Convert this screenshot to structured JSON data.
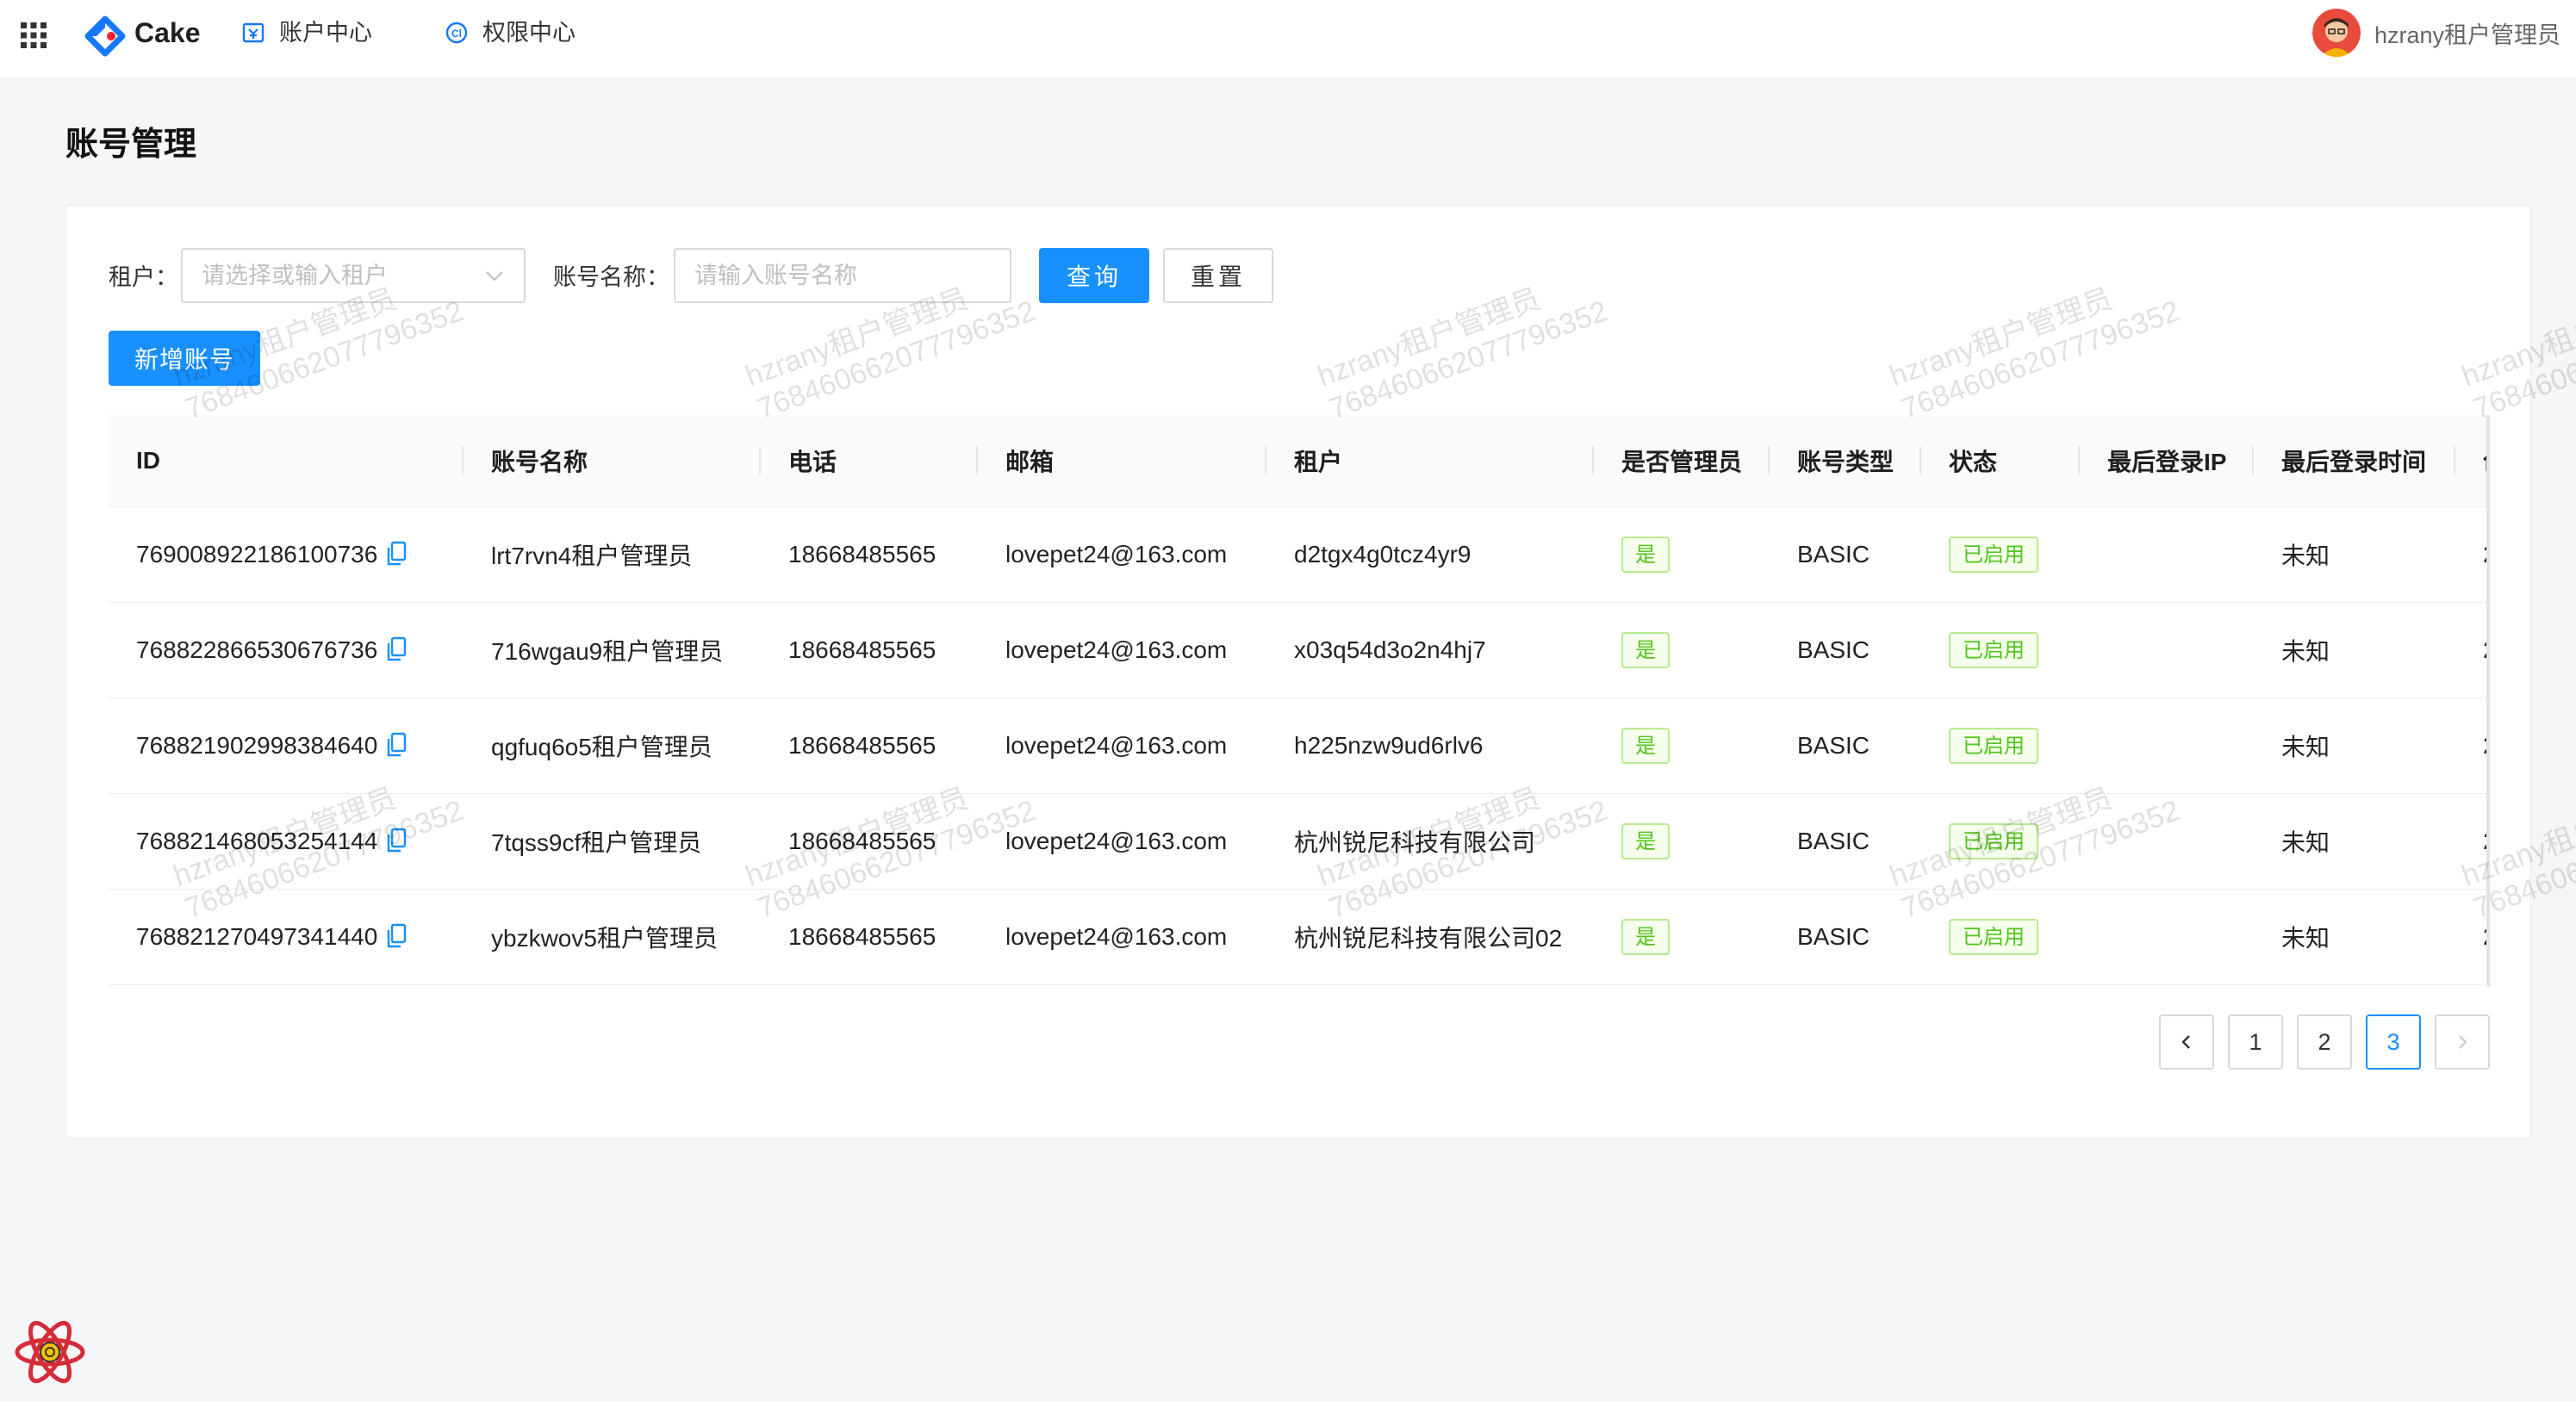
{
  "app": {
    "brand": "Cake",
    "nav": [
      {
        "label": "账户中心",
        "icon": "account-icon"
      },
      {
        "label": "权限中心",
        "icon": "permission-icon"
      }
    ],
    "user": {
      "name": "hzrany租户管理员",
      "avatar": "avatar-icon"
    }
  },
  "page": {
    "title": "账号管理"
  },
  "filters": {
    "tenant_label": "租户：",
    "tenant_placeholder": "请选择或输入租户",
    "account_label": "账号名称：",
    "account_placeholder": "请输入账号名称",
    "query_label": "查询",
    "reset_label": "重置"
  },
  "actions": {
    "add_label": "新增账号"
  },
  "table": {
    "columns": [
      "ID",
      "账号名称",
      "电话",
      "邮箱",
      "租户",
      "是否管理员",
      "账号类型",
      "状态",
      "最后登录IP",
      "最后登录时间",
      "创"
    ],
    "rows": [
      {
        "id": "769008922186100736",
        "name": "lrt7rvn4租户管理员",
        "phone": "18668485565",
        "email": "lovepet24@163.com",
        "tenant": "d2tgx4g0tcz4yr9",
        "admin": "是",
        "type": "BASIC",
        "status": "已启用",
        "ip": "",
        "last_login": "未知",
        "created": "2"
      },
      {
        "id": "768822866530676736",
        "name": "716wgau9租户管理员",
        "phone": "18668485565",
        "email": "lovepet24@163.com",
        "tenant": "x03q54d3o2n4hj7",
        "admin": "是",
        "type": "BASIC",
        "status": "已启用",
        "ip": "",
        "last_login": "未知",
        "created": "2"
      },
      {
        "id": "768821902998384640",
        "name": "qgfuq6o5租户管理员",
        "phone": "18668485565",
        "email": "lovepet24@163.com",
        "tenant": "h225nzw9ud6rlv6",
        "admin": "是",
        "type": "BASIC",
        "status": "已启用",
        "ip": "",
        "last_login": "未知",
        "created": "2"
      },
      {
        "id": "768821468053254144",
        "name": "7tqss9cf租户管理员",
        "phone": "18668485565",
        "email": "lovepet24@163.com",
        "tenant": "杭州锐尼科技有限公司",
        "admin": "是",
        "type": "BASIC",
        "status": "已启用",
        "ip": "",
        "last_login": "未知",
        "created": "2"
      },
      {
        "id": "768821270497341440",
        "name": "ybzkwov5租户管理员",
        "phone": "18668485565",
        "email": "lovepet24@163.com",
        "tenant": "杭州锐尼科技有限公司02",
        "admin": "是",
        "type": "BASIC",
        "status": "已启用",
        "ip": "",
        "last_login": "未知",
        "created": "2"
      }
    ]
  },
  "pagination": {
    "pages": [
      "1",
      "2",
      "3"
    ],
    "current": "3",
    "prev_icon": "chevron-left-icon",
    "next_icon": "chevron-right-icon"
  },
  "watermark": {
    "line1": "hzrany租户管理员",
    "line2": "768460662077796352"
  },
  "colors": {
    "primary": "#1890ff",
    "success": "#52c41a",
    "background": "#f5f6f8"
  }
}
